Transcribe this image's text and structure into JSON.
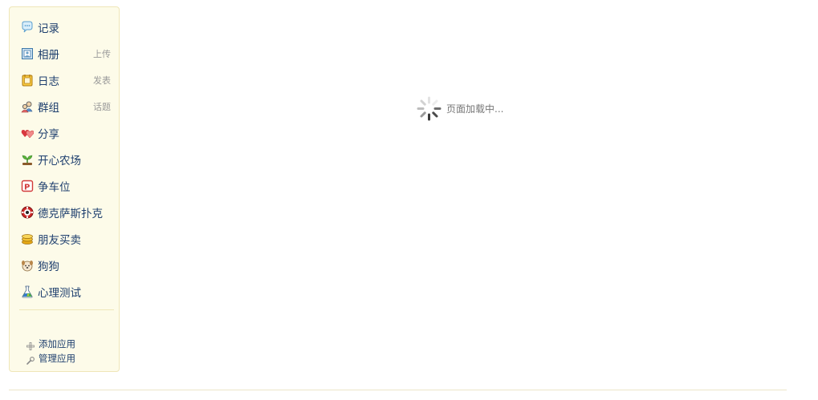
{
  "sidebar": {
    "items": [
      {
        "label": "记录",
        "icon": "speech-bubble-icon"
      },
      {
        "label": "相册",
        "icon": "photo-album-icon",
        "action": "上传"
      },
      {
        "label": "日志",
        "icon": "notebook-icon",
        "action": "发表"
      },
      {
        "label": "群组",
        "icon": "group-icon",
        "action": "话题"
      },
      {
        "label": "分享",
        "icon": "hearts-icon"
      },
      {
        "label": "开心农场",
        "icon": "sprout-icon"
      },
      {
        "label": "争车位",
        "icon": "parking-icon"
      },
      {
        "label": "德克萨斯扑克",
        "icon": "poker-chip-icon"
      },
      {
        "label": "朋友买卖",
        "icon": "coins-icon"
      },
      {
        "label": "狗狗",
        "icon": "dog-icon"
      },
      {
        "label": "心理测试",
        "icon": "flask-icon"
      }
    ],
    "add_app": "添加应用",
    "manage_app": "管理应用"
  },
  "main": {
    "loading_text": "页面加载中..."
  },
  "colors": {
    "sidebar_bg": "#fdfbe9",
    "sidebar_border": "#efe6b8",
    "link": "#1e3f6e",
    "muted": "#999999"
  }
}
